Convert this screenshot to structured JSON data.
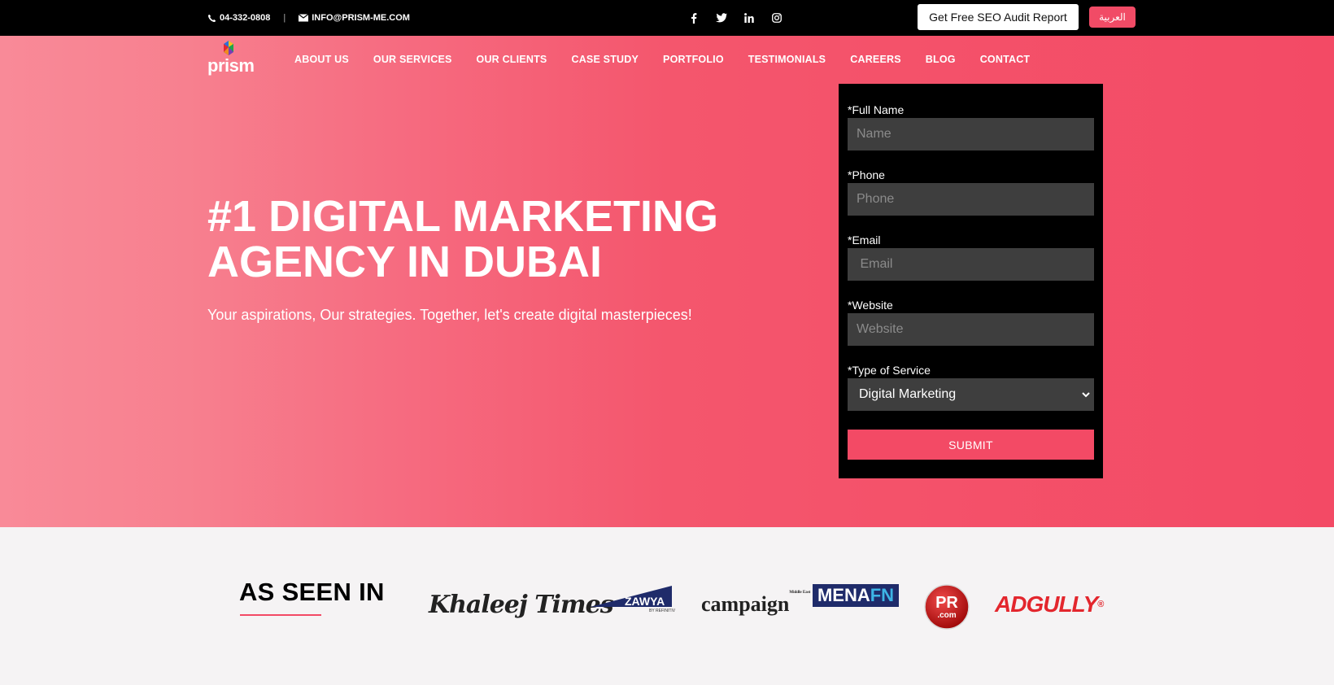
{
  "topbar": {
    "phone": "04-332-0808",
    "separator": "|",
    "email": "INFO@PRISM-ME.COM",
    "social_icons": [
      "facebook-icon",
      "twitter-icon",
      "linkedin-icon",
      "instagram-icon"
    ],
    "seo_button": "Get Free SEO Audit Report",
    "lang_button": "العربية"
  },
  "brand": {
    "logo_text": "prism"
  },
  "nav": {
    "items": [
      {
        "label": "ABOUT US"
      },
      {
        "label": "OUR SERVICES"
      },
      {
        "label": "OUR CLIENTS"
      },
      {
        "label": "CASE STUDY"
      },
      {
        "label": "PORTFOLIO"
      },
      {
        "label": "TESTIMONIALS"
      },
      {
        "label": "CAREERS"
      },
      {
        "label": "BLOG"
      },
      {
        "label": "CONTACT"
      }
    ]
  },
  "hero": {
    "headline_line1": "#1 DIGITAL MARKETING",
    "headline_line2": "AGENCY IN DUBAI",
    "subline": "Your aspirations, Our strategies. Together, let's create digital masterpieces!"
  },
  "form": {
    "full_name": {
      "label": "*Full Name",
      "placeholder": "Name",
      "value": ""
    },
    "phone": {
      "label": "*Phone",
      "placeholder": "Phone",
      "value": ""
    },
    "email": {
      "label": "*Email",
      "placeholder": " Email",
      "value": ""
    },
    "website": {
      "label": "*Website",
      "placeholder": "Website",
      "value": ""
    },
    "service": {
      "label": "*Type of Service",
      "selected": "Digital Marketing"
    },
    "submit": "SUBMIT"
  },
  "seen_in": {
    "title": "AS SEEN IN",
    "logos": {
      "khaleej_times": "Khaleej Times",
      "zawya": "ZAWYA",
      "zawya_sub": "BY REFINITIV",
      "campaign": "campaign",
      "campaign_sub": "Middle East",
      "menafn_a": "MENA",
      "menafn_b": "FN",
      "prcom_a": "PR",
      "prcom_b": ".com",
      "adgully": "ADGULLY",
      "adgully_mark": "®"
    }
  },
  "colors": {
    "accent": "#f34a65",
    "topbar": "#000000",
    "form_bg": "#000000",
    "input_bg": "#3e3e3e"
  }
}
